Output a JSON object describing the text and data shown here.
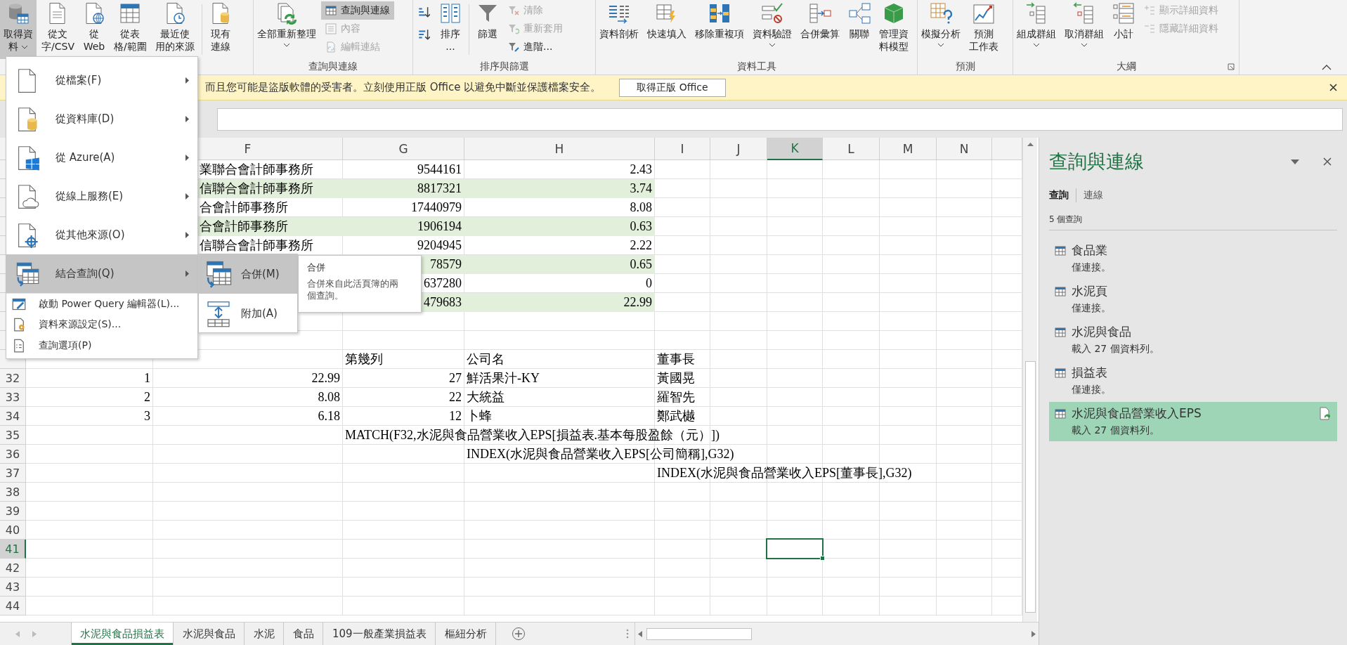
{
  "ribbon": {
    "groups": [
      {
        "launcher": false,
        "buttons": [
          {
            "kind": "large",
            "label": [
              "取得資",
              "料"
            ],
            "pressed": true,
            "disabled": false,
            "dropdown": true
          },
          {
            "kind": "large",
            "label": [
              "從文",
              "字/CSV"
            ],
            "pressed": false,
            "disabled": false,
            "dropdown": false
          },
          {
            "kind": "large",
            "label": [
              "從",
              "Web"
            ],
            "pressed": false,
            "disabled": false,
            "dropdown": false
          },
          {
            "kind": "large",
            "label": [
              "從表",
              "格/範圍"
            ],
            "pressed": false,
            "disabled": false,
            "dropdown": false
          },
          {
            "kind": "large",
            "label": [
              "最近使",
              "用的來源"
            ],
            "pressed": false,
            "disabled": false,
            "dropdown": false
          },
          {
            "kind": "separator"
          },
          {
            "kind": "large",
            "label": [
              "現有",
              "連線"
            ],
            "pressed": false,
            "disabled": false,
            "dropdown": false
          }
        ]
      },
      {
        "label": "查詢與連線",
        "launcher": false,
        "buttons": [
          {
            "kind": "large",
            "label": [
              "全部重新整理"
            ],
            "pressed": false,
            "disabled": false,
            "dropdown": true
          },
          {
            "kind": "stack",
            "items": [
              {
                "label": "查詢與連線",
                "pressed": true,
                "disabled": false
              },
              {
                "label": "內容",
                "pressed": false,
                "disabled": true
              },
              {
                "label": "編輯連結",
                "pressed": false,
                "disabled": true
              }
            ]
          }
        ]
      },
      {
        "label": "排序與篩選",
        "launcher": false,
        "buttons": [
          {
            "kind": "sortpair"
          },
          {
            "kind": "large",
            "label": [
              "排序",
              "..."
            ],
            "pressed": false,
            "disabled": false,
            "dropdown": false
          },
          {
            "kind": "separator"
          },
          {
            "kind": "large",
            "label": [
              "篩選"
            ],
            "pressed": false,
            "disabled": false,
            "dropdown": false
          },
          {
            "kind": "stack",
            "items": [
              {
                "label": "清除",
                "pressed": false,
                "disabled": true
              },
              {
                "label": "重新套用",
                "pressed": false,
                "disabled": true
              },
              {
                "label": "進階...",
                "pressed": false,
                "disabled": false
              }
            ]
          }
        ]
      },
      {
        "label": "資料工具",
        "launcher": false,
        "buttons": [
          {
            "kind": "large",
            "label": [
              "資料剖析"
            ],
            "pressed": false,
            "disabled": false,
            "dropdown": false
          },
          {
            "kind": "large",
            "label": [
              "快速填入"
            ],
            "pressed": false,
            "disabled": false,
            "dropdown": false
          },
          {
            "kind": "large",
            "label": [
              "移除重複項"
            ],
            "pressed": false,
            "disabled": false,
            "dropdown": false
          },
          {
            "kind": "large",
            "label": [
              "資料驗證"
            ],
            "pressed": false,
            "disabled": false,
            "dropdown": true
          },
          {
            "kind": "large",
            "label": [
              "合併彙算"
            ],
            "pressed": false,
            "disabled": false,
            "dropdown": false
          },
          {
            "kind": "large",
            "label": [
              "關聯"
            ],
            "pressed": false,
            "disabled": false,
            "dropdown": false
          },
          {
            "kind": "large",
            "label": [
              "管理資",
              "料模型"
            ],
            "pressed": false,
            "disabled": false,
            "dropdown": false
          }
        ]
      },
      {
        "label": "預測",
        "launcher": false,
        "buttons": [
          {
            "kind": "large",
            "label": [
              "模擬分析"
            ],
            "pressed": false,
            "disabled": false,
            "dropdown": true
          },
          {
            "kind": "large",
            "label": [
              "預測",
              "工作表"
            ],
            "pressed": false,
            "disabled": false,
            "dropdown": false
          }
        ]
      },
      {
        "label": "大綱",
        "launcher": true,
        "buttons": [
          {
            "kind": "large",
            "label": [
              "組成群組"
            ],
            "pressed": false,
            "disabled": false,
            "dropdown": true
          },
          {
            "kind": "large",
            "label": [
              "取消群組"
            ],
            "pressed": false,
            "disabled": false,
            "dropdown": true
          },
          {
            "kind": "large",
            "label": [
              "小計"
            ],
            "pressed": false,
            "disabled": false,
            "dropdown": false
          },
          {
            "kind": "stack",
            "items": [
              {
                "label": "顯示詳細資料",
                "pressed": false,
                "disabled": true
              },
              {
                "label": "隱藏詳細資料",
                "pressed": false,
                "disabled": true
              }
            ]
          }
        ]
      }
    ]
  },
  "notice": {
    "message": "而且您可能是盜版軟體的受害者。立刻使用正版 Office 以避免中斷並保護檔案安全。",
    "button": "取得正版 Office"
  },
  "grid": {
    "columns": [
      {},
      {
        "label": "F",
        "selected": false
      },
      {
        "label": "G",
        "selected": false
      },
      {
        "label": "H",
        "selected": false
      },
      {
        "label": "I",
        "selected": false
      },
      {
        "label": "J",
        "selected": false
      },
      {
        "label": "K",
        "selected": true
      },
      {
        "label": "L",
        "selected": false
      },
      {
        "label": "M",
        "selected": false
      },
      {
        "label": "N",
        "selected": false
      },
      {
        "selected": false
      }
    ],
    "rows": [
      {
        "selected": false,
        "banded": false,
        "cells": [
          null,
          {
            "text": "業聯合會計師事務所",
            "kind": "text"
          },
          {
            "text": "9544161",
            "kind": "number"
          },
          {
            "text": "2.43",
            "kind": "number"
          }
        ]
      },
      {
        "selected": false,
        "banded": true,
        "cells": [
          null,
          {
            "text": "信聯合會計師事務所",
            "kind": "text"
          },
          {
            "text": "8817321",
            "kind": "number"
          },
          {
            "text": "3.74",
            "kind": "number"
          }
        ]
      },
      {
        "selected": false,
        "banded": false,
        "cells": [
          null,
          {
            "text": "合會計師事務所",
            "kind": "text"
          },
          {
            "text": "17440979",
            "kind": "number"
          },
          {
            "text": "8.08",
            "kind": "number"
          }
        ]
      },
      {
        "selected": false,
        "banded": true,
        "cells": [
          null,
          {
            "text": "合會計師事務所",
            "kind": "text"
          },
          {
            "text": "1906194",
            "kind": "number"
          },
          {
            "text": "0.63",
            "kind": "number"
          }
        ]
      },
      {
        "selected": false,
        "banded": false,
        "cells": [
          null,
          {
            "text": "信聯合會計師事務所",
            "kind": "text"
          },
          {
            "text": "9204945",
            "kind": "number"
          },
          {
            "text": "2.22",
            "kind": "number"
          }
        ]
      },
      {
        "selected": false,
        "banded": true,
        "cells": [
          null,
          null,
          {
            "text": "78579",
            "kind": "number"
          },
          {
            "text": "0.65",
            "kind": "number"
          }
        ]
      },
      {
        "selected": false,
        "banded": false,
        "cells": [
          null,
          null,
          {
            "text": "637280",
            "kind": "number"
          },
          {
            "text": "0",
            "kind": "number"
          }
        ]
      },
      {
        "selected": false,
        "banded": true,
        "cells": [
          null,
          null,
          {
            "text": "479683",
            "kind": "number"
          },
          {
            "text": "22.99",
            "kind": "number"
          }
        ]
      },
      {
        "selected": false,
        "banded": false
      },
      {
        "selected": false,
        "banded": false
      },
      {
        "selected": false,
        "banded": false,
        "cells": [
          null,
          null,
          {
            "text": "第幾列",
            "kind": "text"
          },
          {
            "text": "公司名",
            "kind": "text"
          },
          {
            "text": "董事長",
            "kind": "text"
          }
        ]
      },
      {
        "header": "32",
        "selected": false,
        "banded": false,
        "cells": [
          {
            "text": "1",
            "kind": "number"
          },
          {
            "text": "22.99",
            "kind": "number"
          },
          {
            "text": "27",
            "kind": "number"
          },
          {
            "text": "鮮活果汁-KY",
            "kind": "text"
          },
          {
            "text": "黃國晃",
            "kind": "text"
          }
        ]
      },
      {
        "header": "33",
        "selected": false,
        "banded": false,
        "cells": [
          {
            "text": "2",
            "kind": "number"
          },
          {
            "text": "8.08",
            "kind": "number"
          },
          {
            "text": "22",
            "kind": "number"
          },
          {
            "text": "大統益",
            "kind": "text"
          },
          {
            "text": "羅智先",
            "kind": "text"
          }
        ]
      },
      {
        "header": "34",
        "selected": false,
        "banded": false,
        "cells": [
          {
            "text": "3",
            "kind": "number"
          },
          {
            "text": "6.18",
            "kind": "number"
          },
          {
            "text": "12",
            "kind": "number"
          },
          {
            "text": "卜蜂",
            "kind": "text"
          },
          {
            "text": "鄭武樾",
            "kind": "text"
          }
        ]
      },
      {
        "header": "35",
        "selected": false,
        "banded": false,
        "cells": [
          null,
          null,
          {
            "text": "MATCH(F32,水泥與食品營業收入EPS[損益表.基本每股盈餘（元）])",
            "kind": "text"
          }
        ]
      },
      {
        "header": "36",
        "selected": false,
        "banded": false,
        "cells": [
          null,
          null,
          null,
          {
            "text": "INDEX(水泥與食品營業收入EPS[公司簡稱],G32)",
            "kind": "text"
          }
        ]
      },
      {
        "header": "37",
        "selected": false,
        "banded": false,
        "cells": [
          null,
          null,
          null,
          null,
          {
            "text": "INDEX(水泥與食品營業收入EPS[董事長],G32)",
            "kind": "text"
          }
        ]
      },
      {
        "header": "38",
        "selected": false,
        "banded": false
      },
      {
        "header": "39",
        "selected": false,
        "banded": false
      },
      {
        "header": "40",
        "selected": false,
        "banded": false
      },
      {
        "header": "41",
        "selected": true,
        "banded": false
      },
      {
        "header": "42",
        "selected": false,
        "banded": false
      },
      {
        "header": "43",
        "selected": false,
        "banded": false
      },
      {
        "header": "44",
        "selected": false,
        "banded": false
      }
    ]
  },
  "menu": {
    "items": [
      {
        "label": "從檔案(F)",
        "kind": "large",
        "selected": false,
        "has_submenu": true
      },
      {
        "label": "從資料庫(D)",
        "kind": "large",
        "selected": false,
        "has_submenu": true
      },
      {
        "label": "從 Azure(A)",
        "kind": "large",
        "selected": false,
        "has_submenu": true
      },
      {
        "label": "從線上服務(E)",
        "kind": "large",
        "selected": false,
        "has_submenu": true
      },
      {
        "label": "從其他來源(O)",
        "kind": "large",
        "selected": false,
        "has_submenu": true
      },
      {
        "label": "結合查詢(Q)",
        "kind": "large",
        "selected": true,
        "has_submenu": true
      },
      {
        "label": "啟動 Power Query 編輯器(L)...",
        "kind": "small",
        "selected": false,
        "has_submenu": false
      },
      {
        "label": "資料來源設定(S)...",
        "kind": "small",
        "selected": false,
        "has_submenu": false
      },
      {
        "label": "查詢選項(P)",
        "kind": "small",
        "selected": false,
        "has_submenu": false
      }
    ],
    "submenu": {
      "items": [
        {
          "label": "合併(M)",
          "selected": true
        },
        {
          "label": "附加(A)",
          "selected": false
        }
      ],
      "tooltip": {
        "title": "合併",
        "text": "合併來自此活頁簿的兩個查詢。"
      }
    }
  },
  "panel": {
    "title": "查詢與連線",
    "tabs": [
      {
        "label": "查詢",
        "selected": true
      },
      {
        "label": "連線",
        "selected": false
      }
    ],
    "count": "5 個查詢",
    "queries": [
      {
        "name": "食品業",
        "status": "僅連接。",
        "selected": false
      },
      {
        "name": "水泥頁",
        "status": "僅連接。",
        "selected": false
      },
      {
        "name": "水泥與食品",
        "status": "載入 27 個資料列。",
        "selected": false
      },
      {
        "name": "損益表",
        "status": "僅連接。",
        "selected": false
      },
      {
        "name": "水泥與食品營業收入EPS",
        "status": "載入 27 個資料列。",
        "selected": true
      }
    ]
  },
  "sheet_tabs": [
    {
      "label": "水泥與食品損益表",
      "selected": true
    },
    {
      "label": "水泥與食品",
      "selected": false
    },
    {
      "label": "水泥",
      "selected": false
    },
    {
      "label": "食品",
      "selected": false
    },
    {
      "label": "109一般產業損益表",
      "selected": false
    },
    {
      "label": "樞紐分析",
      "selected": false
    }
  ]
}
